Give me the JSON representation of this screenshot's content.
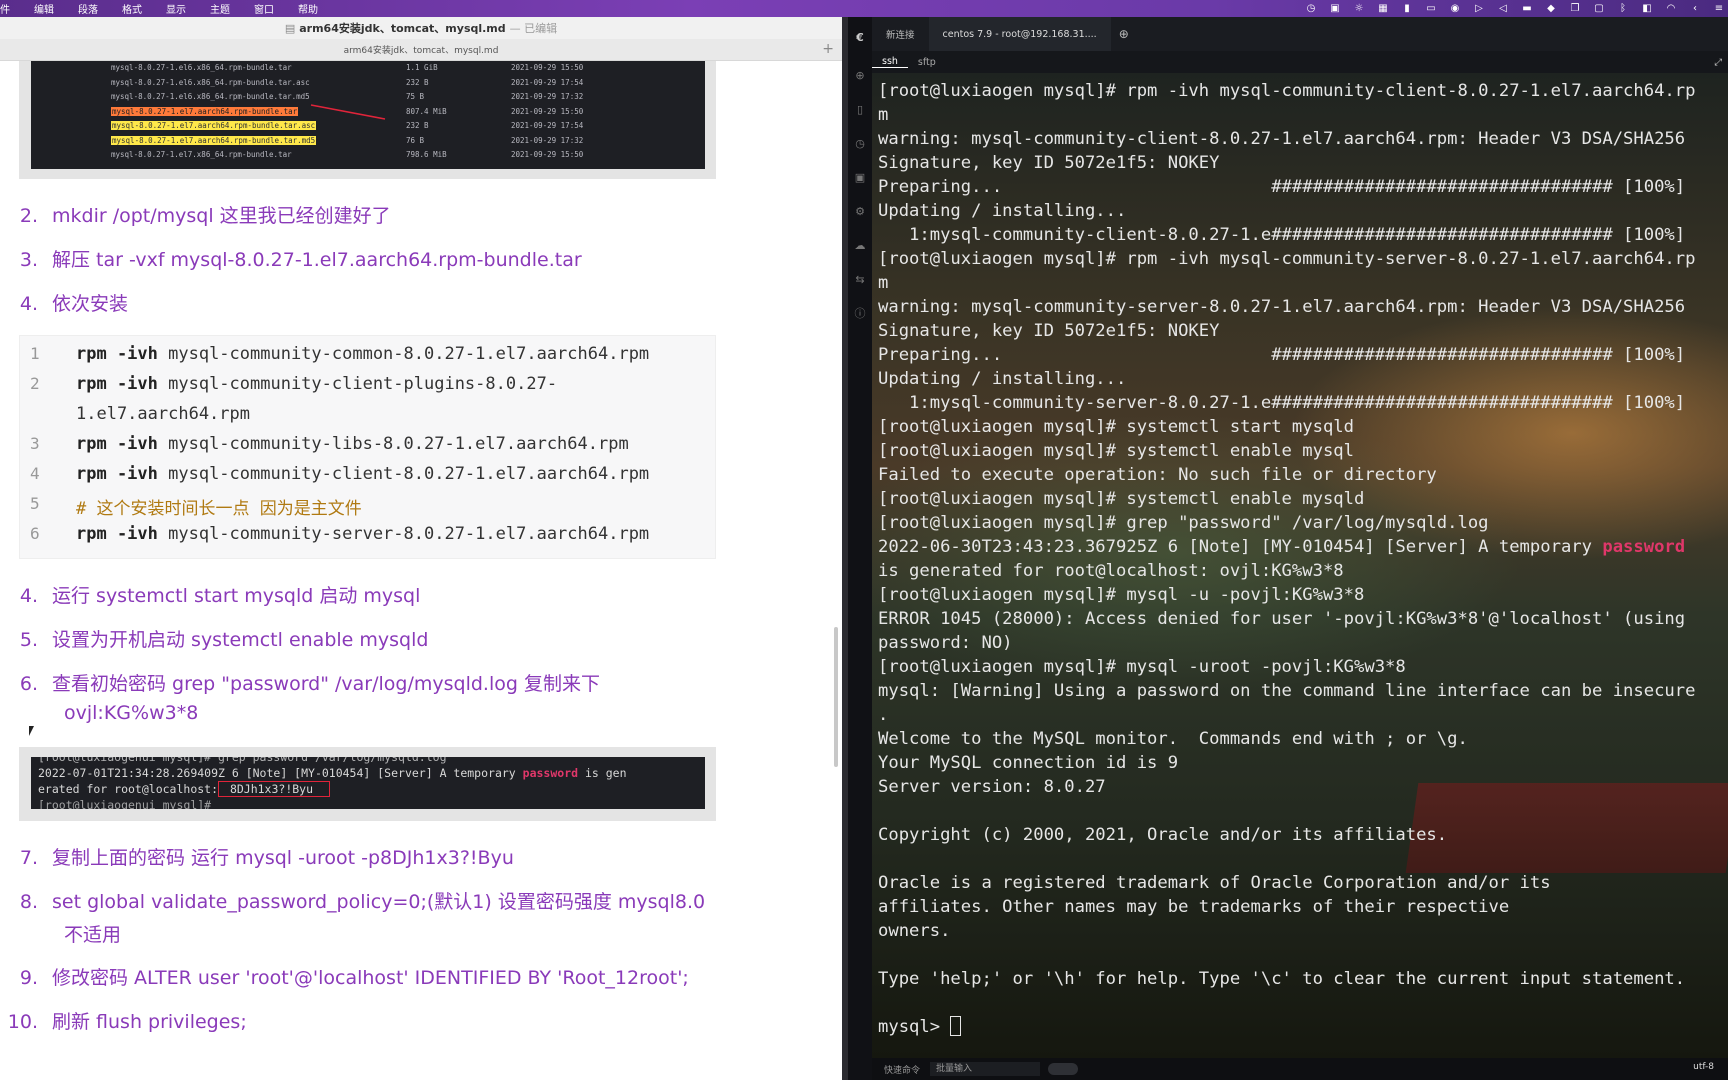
{
  "menubar": {
    "items": [
      "件",
      "编辑",
      "段落",
      "格式",
      "显示",
      "主题",
      "窗口",
      "帮助"
    ]
  },
  "typora": {
    "window_title": "arm64安装jdk、tomcat、mysql.md",
    "window_state": "— 已编辑",
    "tab_label": "arm64安装jdk、tomcat、mysql.md",
    "file_list": [
      [
        "mysql-8.0.27-1.el6.x86_64.rpm-bundle.tar",
        "1.1 GiB",
        "2021-09-29 15:50"
      ],
      [
        "mysql-8.0.27-1.el6.x86_64.rpm-bundle.tar.asc",
        "232 B",
        "2021-09-29 17:54"
      ],
      [
        "mysql-8.0.27-1.el6.x86_64.rpm-bundle.tar.md5",
        "75 B",
        "2021-09-29 17:32"
      ],
      [
        "mysql-8.0.27-1.el7.aarch64.rpm-bundle.tar",
        "807.4 MiB",
        "2021-09-29 15:50"
      ],
      [
        "mysql-8.0.27-1.el7.aarch64.rpm-bundle.tar.asc",
        "232 B",
        "2021-09-29 17:54"
      ],
      [
        "mysql-8.0.27-1.el7.aarch64.rpm-bundle.tar.md5",
        "76 B",
        "2021-09-29 17:32"
      ],
      [
        "mysql-8.0.27-1.el7.x86_64.rpm-bundle.tar",
        "798.6 MiB",
        "2021-09-29 15:50"
      ]
    ],
    "steps_a": [
      {
        "num": "2.",
        "text": "mkdir /opt/mysql  这里我已经创建好了"
      },
      {
        "num": "3.",
        "text": "解压 tar -vxf mysql-8.0.27-1.el7.aarch64.rpm-bundle.tar"
      },
      {
        "num": "4.",
        "text": "依次安装"
      }
    ],
    "code_lines": [
      {
        "ln": "1",
        "kw": "rpm -ivh",
        "rest": " mysql-community-common-8.0.27-1.el7.aarch64.rpm"
      },
      {
        "ln": "2",
        "kw": "rpm -ivh",
        "rest": " mysql-community-client-plugins-8.0.27-"
      },
      {
        "ln": "",
        "kw": "",
        "rest": "1.el7.aarch64.rpm"
      },
      {
        "ln": "3",
        "kw": "rpm -ivh",
        "rest": " mysql-community-libs-8.0.27-1.el7.aarch64.rpm"
      },
      {
        "ln": "4",
        "kw": "rpm -ivh",
        "rest": " mysql-community-client-8.0.27-1.el7.aarch64.rpm"
      },
      {
        "ln": "5",
        "kw": "",
        "rest": "# 这个安装时间长一点  因为是主文件",
        "comment": true
      },
      {
        "ln": "6",
        "kw": "rpm -ivh",
        "rest": " mysql-community-server-8.0.27-1.el7.aarch64.rpm"
      }
    ],
    "steps_b": [
      {
        "num": "4.",
        "text": "运行 systemctl start mysqld 启动 mysql"
      },
      {
        "num": "5.",
        "text": "设置为开机启动 systemctl enable mysqld"
      },
      {
        "num": "6.",
        "text": "查看初始密码  grep \"password\" /var/log/mysqld.log  复制来下"
      },
      {
        "num": "",
        "text": "ovjl:KG%w3*8"
      }
    ],
    "log_shot": {
      "line1": "[root@luxiaogenui mysql]# grep  password  /var/log/mysqld.log",
      "line2a": "2022-07-01T21:34:28.269409Z 6 [Note] [MY-010454] [Server] A temporary ",
      "line2b": "password",
      "line2c": " is gen",
      "line3a": "erated for root@localhost:",
      "line3b": " 8DJh1x3?!Byu",
      "line4": "[root@luxiaogenui mysql]#"
    },
    "steps_c": [
      {
        "num": "7.",
        "text": "复制上面的密码   运行 mysql -uroot -p8DJh1x3?!Byu"
      },
      {
        "num": "8.",
        "text": "set global validate_password_policy=0;(默认1)  设置密码强度   mysql8.0"
      },
      {
        "num": "",
        "text": "不适用"
      },
      {
        "num": "9.",
        "text": "修改密码 ALTER user 'root'@'localhost' IDENTIFIED BY 'Root_12root';"
      },
      {
        "num": "10.",
        "text": "刷新  flush privileges;"
      }
    ]
  },
  "terminal": {
    "tab_new": "新连接",
    "tab_session": "centos 7.9 - root@192.168.31....",
    "subtab_ssh": "ssh",
    "subtab_sftp": "sftp",
    "lines": [
      "[root@luxiaogen mysql]# rpm -ivh mysql-community-client-8.0.27-1.el7.aarch64.rp",
      "m",
      "warning: mysql-community-client-8.0.27-1.el7.aarch64.rpm: Header V3 DSA/SHA256",
      "Signature, key ID 5072e1f5: NOKEY",
      "Preparing...                          ################################# [100%]",
      "Updating / installing...",
      "   1:mysql-community-client-8.0.27-1.e################################# [100%]",
      "[root@luxiaogen mysql]# rpm -ivh mysql-community-server-8.0.27-1.el7.aarch64.rp",
      "m",
      "warning: mysql-community-server-8.0.27-1.el7.aarch64.rpm: Header V3 DSA/SHA256",
      "Signature, key ID 5072e1f5: NOKEY",
      "Preparing...                          ################################# [100%]",
      "Updating / installing...",
      "   1:mysql-community-server-8.0.27-1.e################################# [100%]",
      "[root@luxiaogen mysql]# systemctl start mysqld",
      "[root@luxiaogen mysql]# systemctl enable mysql",
      "Failed to execute operation: No such file or directory",
      "[root@luxiaogen mysql]# systemctl enable mysqld",
      "[root@luxiaogen mysql]# grep \"password\" /var/log/mysqld.log",
      "2022-06-30T23:43:23.367925Z 6 [Note] [MY-010454] [Server] A temporary ",
      "is generated for root@localhost: ovjl:KG%w3*8",
      "[root@luxiaogen mysql]# mysql -u -povjl:KG%w3*8",
      "ERROR 1045 (28000): Access denied for user '-povjl:KG%w3*8'@'localhost' (using",
      "password: NO)",
      "[root@luxiaogen mysql]# mysql -uroot -povjl:KG%w3*8",
      "mysql: [Warning] Using a password on the command line interface can be insecure",
      ".",
      "Welcome to the MySQL monitor.  Commands end with ; or \\g.",
      "Your MySQL connection id is 9",
      "Server version: 8.0.27",
      "",
      "Copyright (c) 2000, 2021, Oracle and/or its affiliates.",
      "",
      "Oracle is a registered trademark of Oracle Corporation and/or its",
      "affiliates. Other names may be trademarks of their respective",
      "owners.",
      "",
      "Type 'help;' or '\\h' for help. Type '\\c' to clear the current input statement.",
      ""
    ],
    "highlight_word": "password",
    "prompt": "mysql> ",
    "status": {
      "quick_cmd": "快速命令",
      "batch_input": "批量输入",
      "encoding": "utf-8"
    }
  }
}
